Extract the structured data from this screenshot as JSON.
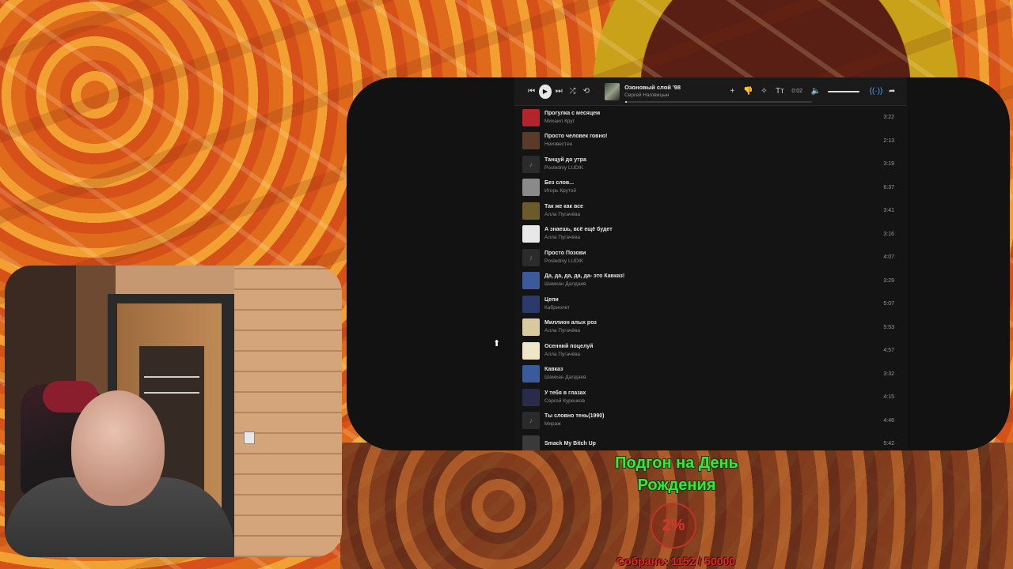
{
  "player": {
    "now_playing": {
      "title": "Озоновый слой '98",
      "artist": "Сергей Наговицын",
      "elapsed": "0:02",
      "progress_fraction": 0.01
    },
    "volume_fraction": 1.0
  },
  "tracks": [
    {
      "title": "Прогулка с месяцем",
      "artist": "Михаил Круг",
      "duration": "3:22",
      "cover": "#b2252b"
    },
    {
      "title": "Просто человек говно!",
      "artist": "Неизвестен",
      "duration": "2:13",
      "cover": "#5a3b2a"
    },
    {
      "title": "Танцуй до утра",
      "artist": "Posledniy LUDIK",
      "duration": "3:19",
      "cover": "#2b2b2b"
    },
    {
      "title": "Без слов...",
      "artist": "Игорь Крутой",
      "duration": "6:37",
      "cover": "#8a8a8a"
    },
    {
      "title": "Так же как все",
      "artist": "Алла Пугачёва",
      "duration": "3:41",
      "cover": "#6b5a2a"
    },
    {
      "title": "А знаешь, всё ещё будет",
      "artist": "Алла Пугачёва",
      "duration": "3:16",
      "cover": "#e8e8e8"
    },
    {
      "title": "Просто Позови",
      "artist": "Posledniy LUDIK",
      "duration": "4:07",
      "cover": "#2b2b2b"
    },
    {
      "title": "Да, да, да, да, да- это Кавказ!",
      "artist": "Шамхан Далдаев",
      "duration": "3:29",
      "cover": "#3a5a9a"
    },
    {
      "title": "Цепи",
      "artist": "Кабриолет",
      "duration": "5:07",
      "cover": "#2a3a6a"
    },
    {
      "title": "Миллион алых роз",
      "artist": "Алла Пугачёва",
      "duration": "5:53",
      "cover": "#d8c9a0"
    },
    {
      "title": "Осенний поцелуй",
      "artist": "Алла Пугачёва",
      "duration": "4:57",
      "cover": "#efe6c8"
    },
    {
      "title": "Кавказ",
      "artist": "Шамхан Далдаев",
      "duration": "3:32",
      "cover": "#3a5a9a"
    },
    {
      "title": "У тебя в глазах",
      "artist": "Сергей Куренков",
      "duration": "4:15",
      "cover": "#2a2a4a"
    },
    {
      "title": "Ты словно тень(1990)",
      "artist": "Мираж",
      "duration": "4:46",
      "cover": "#2b2b2b"
    },
    {
      "title": "Smack My Bitch Up",
      "artist": "",
      "duration": "5:42",
      "cover": "#3a3a3a"
    }
  ],
  "donation_goal": {
    "title": "Подгон на День Рождения",
    "percent": "2%",
    "collected": "Собрано: 1152 / 50000"
  },
  "icons": {
    "prev": "⏮",
    "play": "▶",
    "next": "⏭",
    "shuffle": "⤮",
    "repeat": "⟲",
    "add": "+",
    "dislike": "👎",
    "star": "✧",
    "lyrics": "Tт",
    "mute": "🔈",
    "broadcast": "((·))",
    "share": "➦",
    "note": "♪"
  },
  "colors": {
    "accent": "#4aa3ff",
    "goal_green": "#39e63a",
    "goal_red": "#d8362c"
  }
}
